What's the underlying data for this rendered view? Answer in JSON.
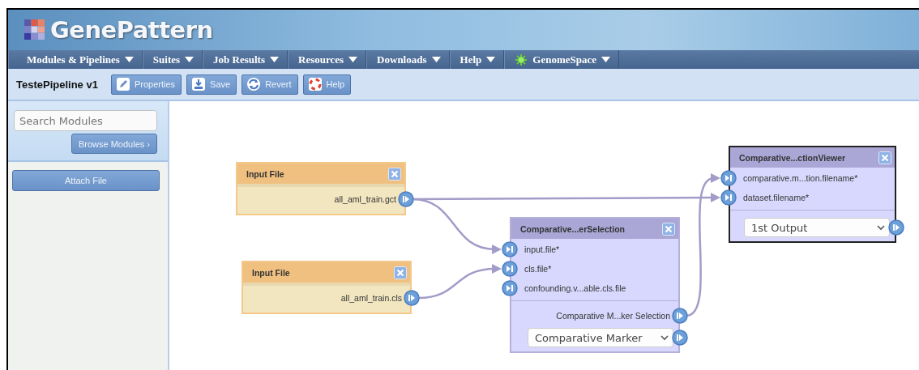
{
  "header": {
    "logo": "GenePattern"
  },
  "menu": [
    {
      "label": "Modules & Pipelines",
      "icon": false
    },
    {
      "label": "Suites",
      "icon": false
    },
    {
      "label": "Job Results",
      "icon": false
    },
    {
      "label": "Resources",
      "icon": false
    },
    {
      "label": "Downloads",
      "icon": false
    },
    {
      "label": "Help",
      "icon": false
    },
    {
      "label": "GenomeSpace",
      "icon": true
    }
  ],
  "toolbar": {
    "title": "TestePipeline v1",
    "buttons": [
      {
        "kind": "properties",
        "label": "Properties"
      },
      {
        "kind": "save",
        "label": "Save"
      },
      {
        "kind": "revert",
        "label": "Revert"
      },
      {
        "kind": "help",
        "label": "Help"
      }
    ]
  },
  "sidebar": {
    "search": {
      "placeholder": "Search Modules"
    },
    "browse_button": "Browse Modules ›",
    "attach_button": "Attach File"
  },
  "nodes": [
    {
      "kind": "file",
      "title": "Input File",
      "selected": false,
      "outputs": [
        "all_aml_train.gct"
      ]
    },
    {
      "kind": "file",
      "title": "Input File",
      "selected": false,
      "outputs": [
        "all_aml_train.cls"
      ]
    },
    {
      "kind": "module",
      "title": "Comparative...erSelection",
      "selected": false,
      "inputs": [
        "input.file*",
        "cls.file*",
        "confounding.v...able.cls.file"
      ],
      "outputs": [
        "Comparative M...ker Selection"
      ],
      "output_select": "Comparative Marker"
    },
    {
      "kind": "module",
      "title": "Comparative...ctionViewer",
      "selected": true,
      "inputs": [
        "comparative.m...tion.filename*",
        "dataset.filename*"
      ],
      "output_select": "1st Output"
    }
  ]
}
